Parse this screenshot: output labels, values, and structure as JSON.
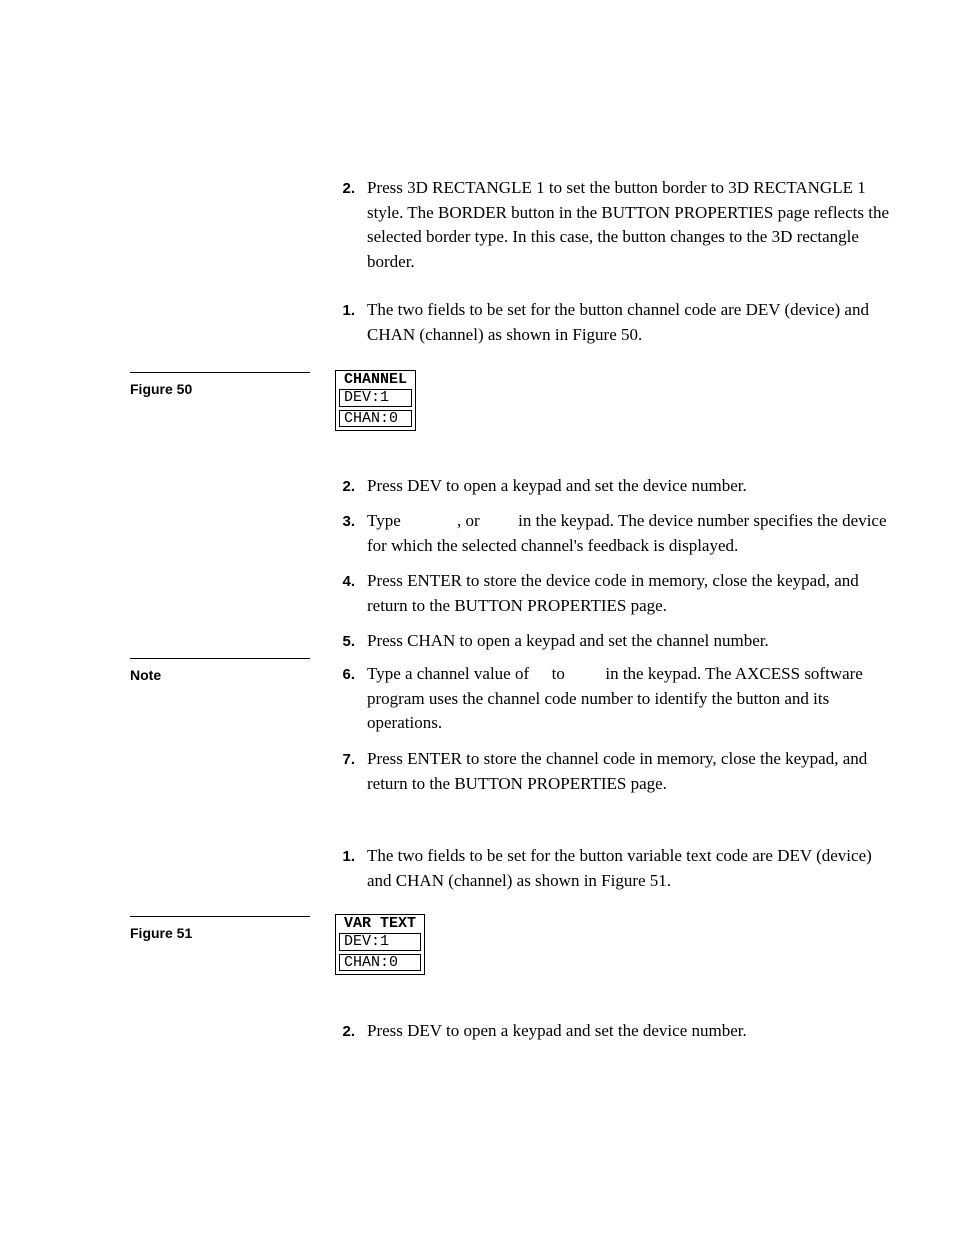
{
  "section1": {
    "item2": {
      "num": "2.",
      "text": "Press 3D RECTANGLE 1 to set the button border to 3D RECTANGLE 1 style. The BORDER button in the BUTTON PROPERTIES page reflects the selected border type. In this case, the button changes to the 3D rectangle border."
    }
  },
  "section2": {
    "item1": {
      "num": "1.",
      "text": "The two fields to be set for the button channel code are DEV (device) and CHAN (channel) as shown in Figure 50."
    },
    "item2": {
      "num": "2.",
      "text": "Press DEV to open a keypad and set the device number."
    },
    "item3": {
      "num": "3.",
      "pre": "Type ",
      "mid": ", or ",
      "post": " in the keypad. The device number specifies the device for which the selected channel's feedback is displayed."
    },
    "item4": {
      "num": "4.",
      "text": "Press ENTER to store the device code in memory, close the keypad, and return to the BUTTON PROPERTIES page."
    },
    "item5": {
      "num": "5.",
      "text": "Press CHAN to open a keypad and set the channel number."
    },
    "item6": {
      "num": "6.",
      "pre": "Type a channel value of ",
      "mid": " to ",
      "post": " in the keypad. The AXCESS software program uses the channel code number to identify the button and its operations."
    },
    "item7": {
      "num": "7.",
      "text": "Press ENTER to store the channel code in memory, close the keypad, and return to the BUTTON PROPERTIES page."
    }
  },
  "section3": {
    "item1": {
      "num": "1.",
      "text": "The two fields to be set for the button variable text code are DEV (device) and CHAN (channel) as shown in Figure 51."
    },
    "item2": {
      "num": "2.",
      "text": "Press DEV to open a keypad and set the device number."
    }
  },
  "sidebar": {
    "fig50": "Figure 50",
    "note": "Note",
    "fig51": "Figure 51"
  },
  "lcd50": {
    "title": "CHANNEL",
    "r1": "DEV:1",
    "r2": "CHAN:0"
  },
  "lcd51": {
    "title": "VAR TEXT",
    "r1": "DEV:1",
    "r2": "CHAN:0"
  }
}
